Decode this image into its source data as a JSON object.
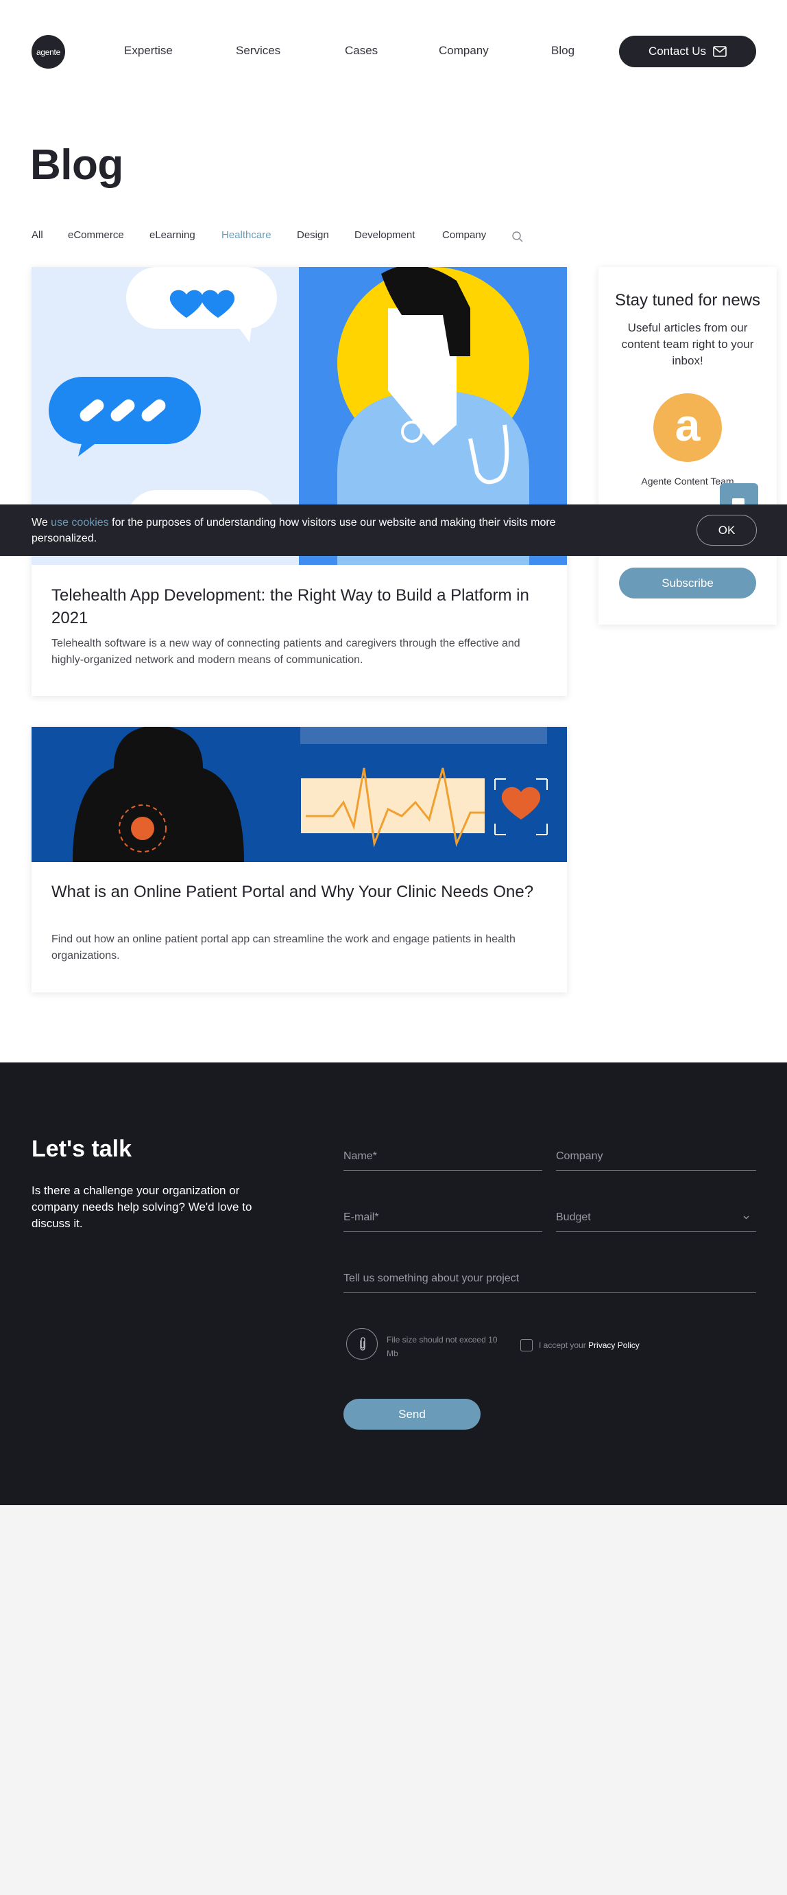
{
  "header": {
    "logo_text": "agente",
    "nav": [
      "Expertise",
      "Services",
      "Cases",
      "Company",
      "Blog"
    ],
    "contact_label": "Contact Us"
  },
  "page_title": "Blog",
  "categories": [
    "All",
    "eCommerce",
    "eLearning",
    "Healthcare",
    "Design",
    "Development",
    "Company"
  ],
  "active_category": "Healthcare",
  "posts": [
    {
      "title": "Telehealth App Development: the Right Way to Build a Platform in 2021",
      "description": "Telehealth software is a new way of connecting patients and caregivers through the effective and highly-organized network and modern means of communication."
    },
    {
      "title": "What is an Online Patient Portal and Why Your Clinic Needs One?",
      "description": "Find out how an online patient portal app can streamline the work and engage patients in health organizations."
    }
  ],
  "newsletter": {
    "title": "Stay tuned for news",
    "subtitle": "Useful articles from our content team right to your inbox!",
    "avatar_letter": "a",
    "author": "Agente Content Team",
    "subscribe_label": "Subscribe"
  },
  "cookie_bar": {
    "prefix": "We",
    "link": "use cookies",
    "suffix": "for the purposes of understanding how visitors use our website and making their visits more personalized.",
    "ok_label": "OK"
  },
  "contact_form": {
    "title": "Let's talk",
    "text": "Is there a challenge your organization or company needs help solving? We'd love to discuss it.",
    "name_label": "Name*",
    "company_label": "Company",
    "email_label": "E-mail*",
    "budget_label": "Budget",
    "project_label": "Tell us something about your project",
    "file_note": "File size should not exceed 10 Mb",
    "privacy_prefix": "I accept your",
    "privacy_link": "Privacy Policy",
    "send_label": "Send"
  },
  "colors": {
    "accent": "#6a9bb8",
    "dark": "#23232b",
    "footer_bg": "#191920",
    "avatar": "#f5b454"
  }
}
